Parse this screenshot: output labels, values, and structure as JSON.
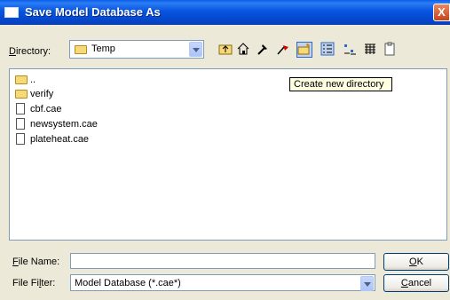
{
  "window": {
    "title": "Save Model Database As",
    "close_glyph": "X"
  },
  "directory": {
    "label_mnemonic": "D",
    "label_rest": "irectory:",
    "value": "Temp"
  },
  "toolbar": {
    "icons": [
      "up-folder-icon",
      "home-icon",
      "hammer-icon",
      "arrow-tool-icon",
      "new-folder-icon",
      "details-view-icon",
      "list-view-icon",
      "thumbnail-view-icon",
      "clipboard-icon"
    ]
  },
  "files": [
    {
      "name": "..",
      "type": "folder"
    },
    {
      "name": "verify",
      "type": "folder"
    },
    {
      "name": "cbf.cae",
      "type": "file"
    },
    {
      "name": "newsystem.cae",
      "type": "file"
    },
    {
      "name": "plateheat.cae",
      "type": "file"
    }
  ],
  "tooltip": "Create new directory",
  "file_name": {
    "label_mnemonic": "F",
    "label_rest": "ile Name:",
    "value": ""
  },
  "file_filter": {
    "label_pre": "File Fi",
    "label_mnemonic": "l",
    "label_post": "ter:",
    "value": "Model Database (*.cae*)"
  },
  "buttons": {
    "ok_mnemonic": "O",
    "ok_rest": "K",
    "cancel_mnemonic": "C",
    "cancel_rest": "ancel"
  }
}
